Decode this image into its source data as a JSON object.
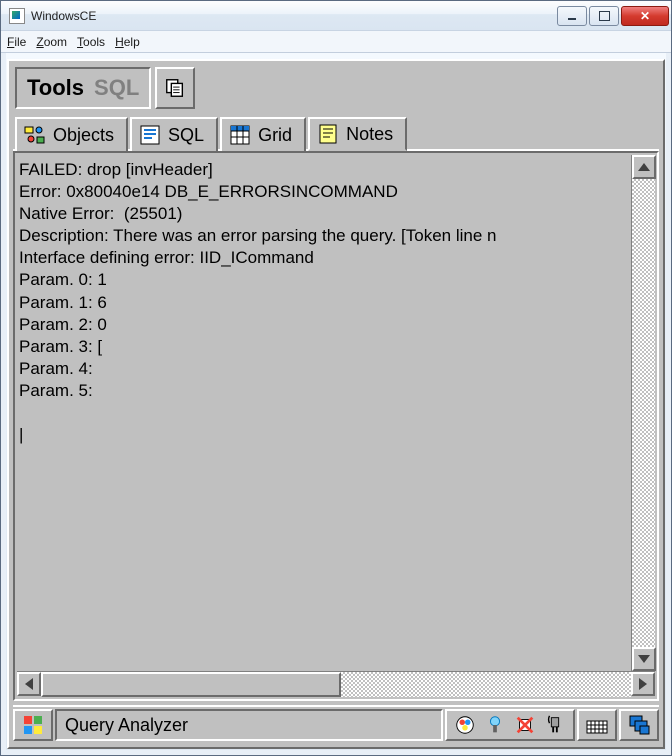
{
  "window": {
    "title": "WindowsCE"
  },
  "menubar": {
    "file": "File",
    "zoom": "Zoom",
    "tools": "Tools",
    "help": "Help"
  },
  "toolbar": {
    "tools_label": "Tools",
    "sql_label": "SQL"
  },
  "tabs": {
    "objects": "Objects",
    "sql": "SQL",
    "grid": "Grid",
    "notes": "Notes"
  },
  "notes": {
    "lines": [
      "FAILED: drop [invHeader]",
      "Error: 0x80040e14 DB_E_ERRORSINCOMMAND",
      "Native Error:  (25501)",
      "Description: There was an error parsing the query. [Token line n",
      "Interface defining error: IID_ICommand",
      "Param. 0: 1",
      "Param. 1: 6",
      "Param. 2: 0",
      "Param. 3: [",
      "Param. 4:",
      "Param. 5:"
    ]
  },
  "statusbar": {
    "label": "Query Analyzer"
  }
}
